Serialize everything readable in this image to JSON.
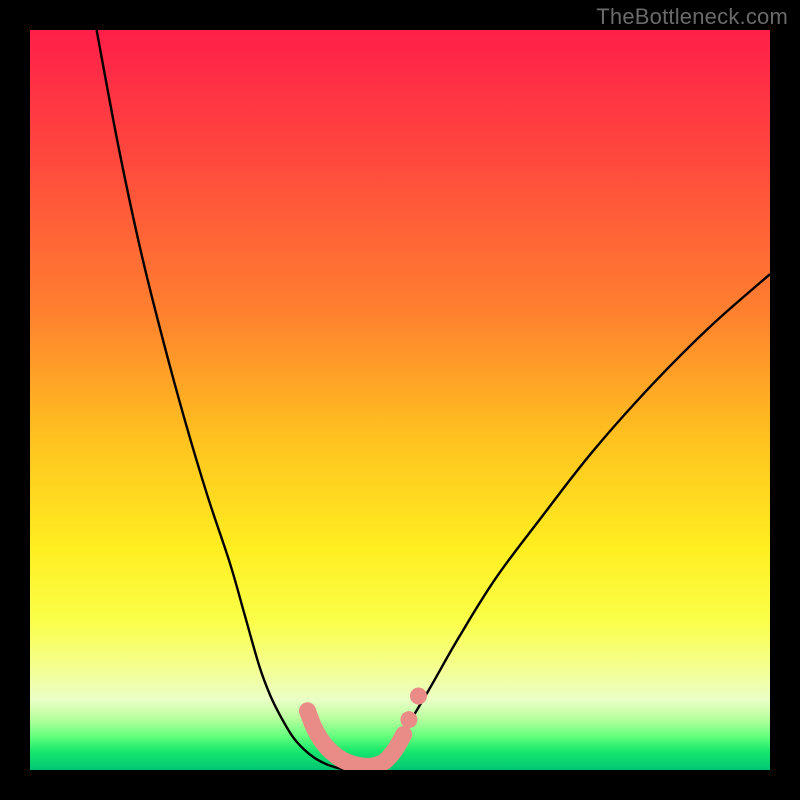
{
  "watermark": "TheBottleneck.com",
  "chart_data": {
    "type": "line",
    "title": "",
    "xlabel": "",
    "ylabel": "",
    "xlim": [
      0,
      100
    ],
    "ylim": [
      0,
      100
    ],
    "grid": false,
    "series": [
      {
        "name": "left-curve",
        "x": [
          9,
          12,
          15,
          18,
          21,
          24,
          27,
          29,
          31,
          32.5,
          34,
          35.5,
          37,
          38.5,
          40,
          41.5,
          43
        ],
        "y": [
          100,
          84,
          70,
          58,
          47,
          37,
          28,
          21,
          14,
          10,
          7,
          4.5,
          2.8,
          1.6,
          0.8,
          0.3,
          0
        ]
      },
      {
        "name": "right-curve",
        "x": [
          47,
          49,
          51,
          54,
          58,
          63,
          69,
          76,
          84,
          92,
          100
        ],
        "y": [
          0,
          3,
          6,
          11,
          18,
          26,
          34,
          43,
          52,
          60,
          67
        ]
      },
      {
        "name": "floor-markers",
        "x": [
          37.5,
          38.5,
          40,
          42,
          44,
          46,
          47.5,
          48.5,
          49.5,
          50.5,
          51.2,
          51.8,
          52.5,
          53.2
        ],
        "y": [
          8,
          5.5,
          3.2,
          1.5,
          0.7,
          0.5,
          0.9,
          1.7,
          3,
          4.8,
          6.8,
          8.5,
          10,
          11
        ]
      }
    ],
    "gradient_stops": [
      {
        "offset": 0,
        "color": "#ff1f4a"
      },
      {
        "offset": 0.18,
        "color": "#ff4a3d"
      },
      {
        "offset": 0.38,
        "color": "#ff802f"
      },
      {
        "offset": 0.55,
        "color": "#ffc11f"
      },
      {
        "offset": 0.7,
        "color": "#ffee20"
      },
      {
        "offset": 0.8,
        "color": "#faff4a"
      },
      {
        "offset": 0.86,
        "color": "#f4ff8f"
      },
      {
        "offset": 0.905,
        "color": "#eaffc6"
      },
      {
        "offset": 0.93,
        "color": "#b9ff9e"
      },
      {
        "offset": 0.955,
        "color": "#62ff7c"
      },
      {
        "offset": 0.975,
        "color": "#17e86d"
      },
      {
        "offset": 1.0,
        "color": "#00c574"
      }
    ],
    "marker_color": "#e98b86",
    "curve_color": "#000000"
  }
}
